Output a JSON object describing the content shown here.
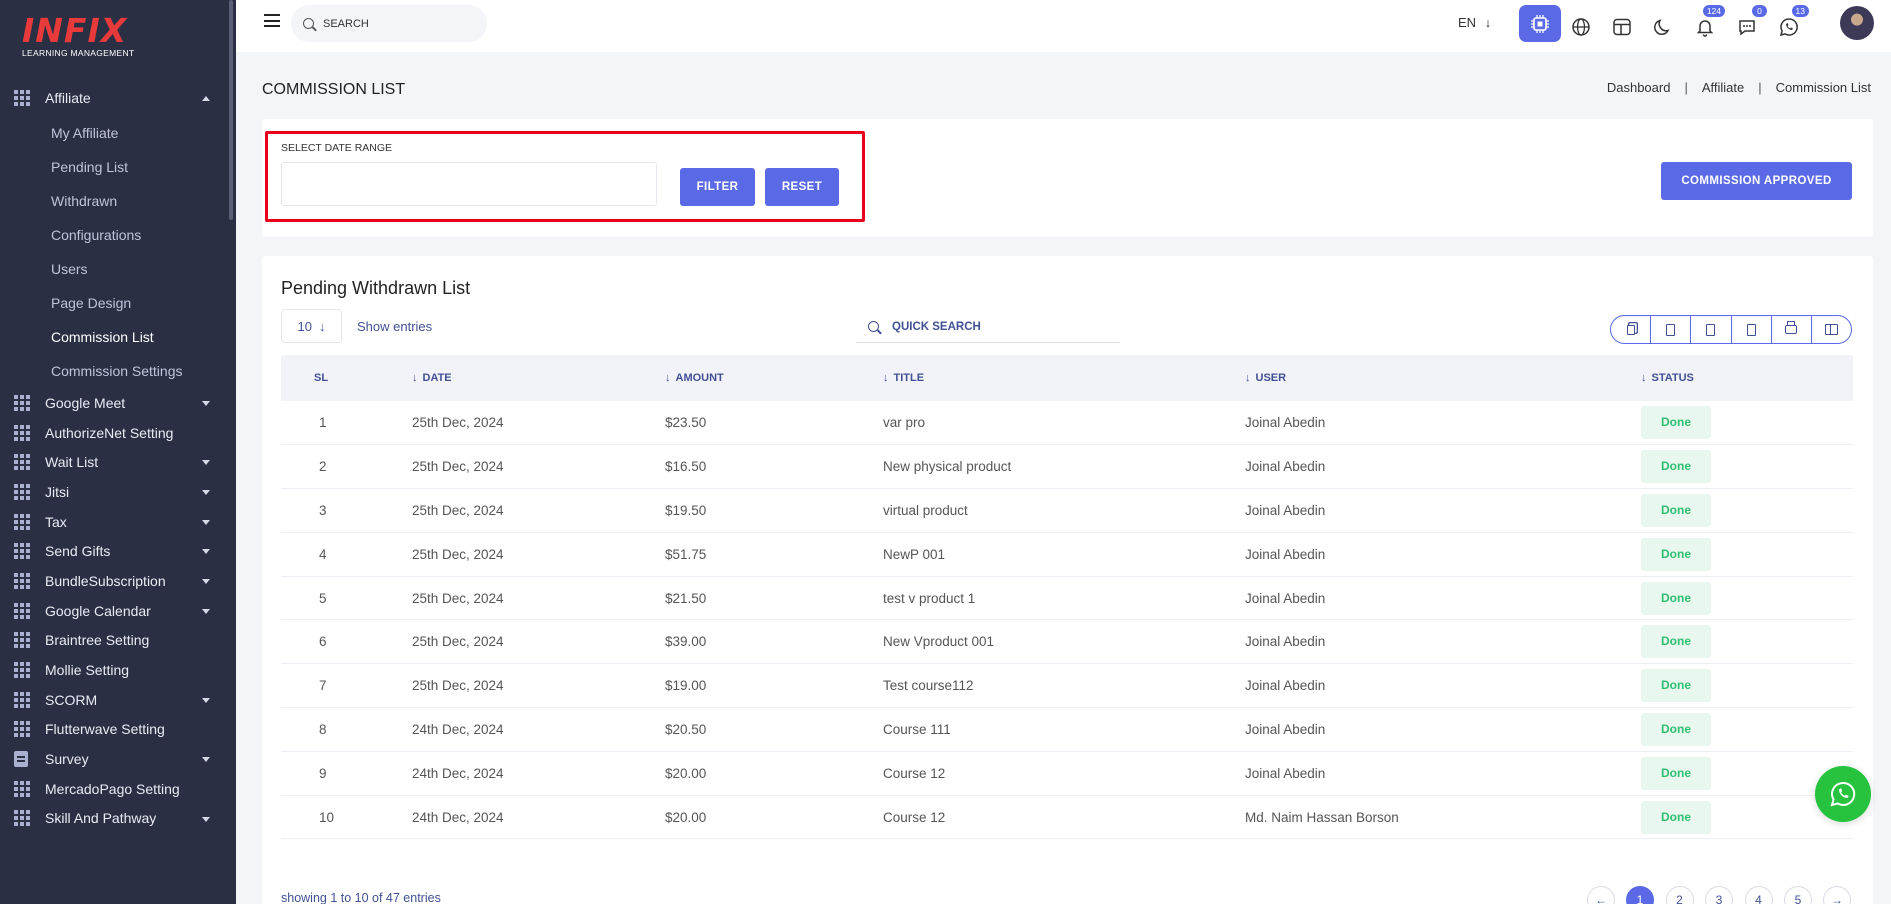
{
  "brand": {
    "logo_text": "INFIX",
    "logo_sub": "LEARNING MANAGEMENT",
    "logo_color": "#e83a3a"
  },
  "colors": {
    "sidebar_bg": "#2b2f44",
    "accent": "#5a6ae6",
    "highlight_border": "#e8001c",
    "status_done": "#2fbf71"
  },
  "topbar": {
    "search_placeholder": "SEARCH",
    "language": "EN",
    "notifications_count": "124",
    "messages_count": "0",
    "whatsapp_count": "13",
    "icons": [
      "hamburger-icon",
      "search-icon",
      "chip-icon",
      "globe-icon",
      "layout-icon",
      "moon-icon",
      "bell-icon",
      "chat-icon",
      "whatsapp-icon"
    ]
  },
  "sidebar": {
    "active_group": "Affiliate",
    "affiliate_sub": [
      "My Affiliate",
      "Pending List",
      "Withdrawn",
      "Configurations",
      "Users",
      "Page Design",
      "Commission List",
      "Commission Settings"
    ],
    "active_sub": "Commission List",
    "items": [
      {
        "label": "Google Meet",
        "caret": true
      },
      {
        "label": "AuthorizeNet Setting",
        "caret": false
      },
      {
        "label": "Wait List",
        "caret": true
      },
      {
        "label": "Jitsi",
        "caret": true
      },
      {
        "label": "Tax",
        "caret": true
      },
      {
        "label": "Send Gifts",
        "caret": true
      },
      {
        "label": "BundleSubscription",
        "caret": true
      },
      {
        "label": "Google Calendar",
        "caret": true
      },
      {
        "label": "Braintree Setting",
        "caret": false
      },
      {
        "label": "Mollie Setting",
        "caret": false
      },
      {
        "label": "SCORM",
        "caret": true
      },
      {
        "label": "Flutterwave Setting",
        "caret": false
      },
      {
        "label": "Survey",
        "caret": true,
        "icon": "doc"
      },
      {
        "label": "MercadoPago Setting",
        "caret": false
      },
      {
        "label": "Skill And Pathway",
        "caret": true
      }
    ]
  },
  "page": {
    "title": "COMMISSION LIST",
    "breadcrumb": [
      "Dashboard",
      "Affiliate",
      "Commission List"
    ]
  },
  "filter": {
    "date_label": "SELECT DATE RANGE",
    "date_value": "",
    "filter_button": "FILTER",
    "reset_button": "RESET",
    "commission_approved_button": "COMMISSION APPROVED"
  },
  "list": {
    "title": "Pending Withdrawn List",
    "entries_value": "10",
    "show_entries": "Show entries",
    "quick_search": "QUICK SEARCH",
    "export_icons": [
      "copy-icon",
      "csv-icon",
      "excel-icon",
      "pdf-icon",
      "print-icon",
      "columns-icon"
    ],
    "columns": [
      "SL",
      "DATE",
      "AMOUNT",
      "TITLE",
      "USER",
      "STATUS"
    ],
    "rows": [
      {
        "sl": "1",
        "date": "25th Dec, 2024",
        "amount": "$23.50",
        "title": "var pro",
        "user": "Joinal Abedin",
        "status": "Done"
      },
      {
        "sl": "2",
        "date": "25th Dec, 2024",
        "amount": "$16.50",
        "title": "New physical product",
        "user": "Joinal Abedin",
        "status": "Done"
      },
      {
        "sl": "3",
        "date": "25th Dec, 2024",
        "amount": "$19.50",
        "title": "virtual product",
        "user": "Joinal Abedin",
        "status": "Done"
      },
      {
        "sl": "4",
        "date": "25th Dec, 2024",
        "amount": "$51.75",
        "title": "NewP 001",
        "user": "Joinal Abedin",
        "status": "Done"
      },
      {
        "sl": "5",
        "date": "25th Dec, 2024",
        "amount": "$21.50",
        "title": "test v product 1",
        "user": "Joinal Abedin",
        "status": "Done"
      },
      {
        "sl": "6",
        "date": "25th Dec, 2024",
        "amount": "$39.00",
        "title": "New Vproduct 001",
        "user": "Joinal Abedin",
        "status": "Done"
      },
      {
        "sl": "7",
        "date": "25th Dec, 2024",
        "amount": "$19.00",
        "title": "Test course112",
        "user": "Joinal Abedin",
        "status": "Done"
      },
      {
        "sl": "8",
        "date": "24th Dec, 2024",
        "amount": "$20.50",
        "title": "Course 111",
        "user": "Joinal Abedin",
        "status": "Done"
      },
      {
        "sl": "9",
        "date": "24th Dec, 2024",
        "amount": "$20.00",
        "title": "Course 12",
        "user": "Joinal Abedin",
        "status": "Done"
      },
      {
        "sl": "10",
        "date": "24th Dec, 2024",
        "amount": "$20.00",
        "title": "Course 12",
        "user": "Md. Naim Hassan Borson",
        "status": "Done"
      }
    ],
    "showing_text": "showing 1 to 10 of 47 entries",
    "pages": [
      "1",
      "2",
      "3",
      "4",
      "5"
    ],
    "active_page": "1"
  }
}
